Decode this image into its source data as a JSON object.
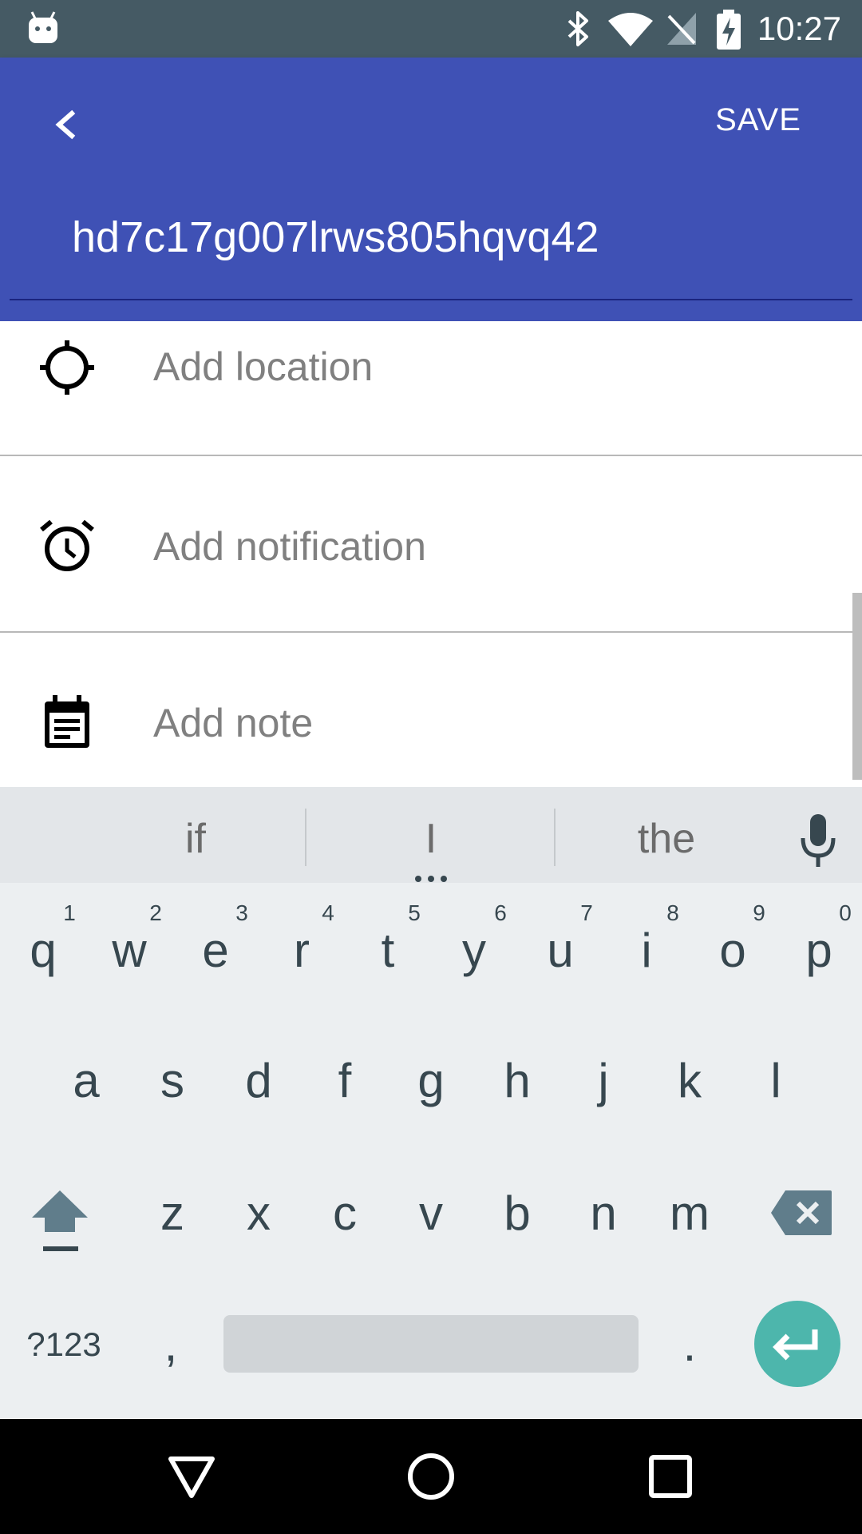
{
  "status_bar": {
    "time": "10:27",
    "icons": [
      "android-icon",
      "bluetooth-icon",
      "wifi-icon",
      "no-signal-icon",
      "battery-charging-icon"
    ]
  },
  "app_bar": {
    "save_label": "SAVE",
    "title_value": "hd7c17g007lrws805hqvq42",
    "accent_color": "#3f51b5"
  },
  "rows": [
    {
      "label": "Add location",
      "icon": "location-target-icon"
    },
    {
      "label": "Add notification",
      "icon": "alarm-clock-icon"
    },
    {
      "label": "Add note",
      "icon": "note-calendar-icon"
    }
  ],
  "keyboard": {
    "suggestions": [
      "if",
      "I",
      "the"
    ],
    "row1": [
      "q",
      "w",
      "e",
      "r",
      "t",
      "y",
      "u",
      "i",
      "o",
      "p"
    ],
    "row1_hints": [
      "1",
      "2",
      "3",
      "4",
      "5",
      "6",
      "7",
      "8",
      "9",
      "0"
    ],
    "row2": [
      "a",
      "s",
      "d",
      "f",
      "g",
      "h",
      "j",
      "k",
      "l"
    ],
    "row3": [
      "z",
      "x",
      "c",
      "v",
      "b",
      "n",
      "m"
    ],
    "symbols_label": "?123",
    "comma": ",",
    "period": ".",
    "enter_color": "#4db6ac"
  }
}
